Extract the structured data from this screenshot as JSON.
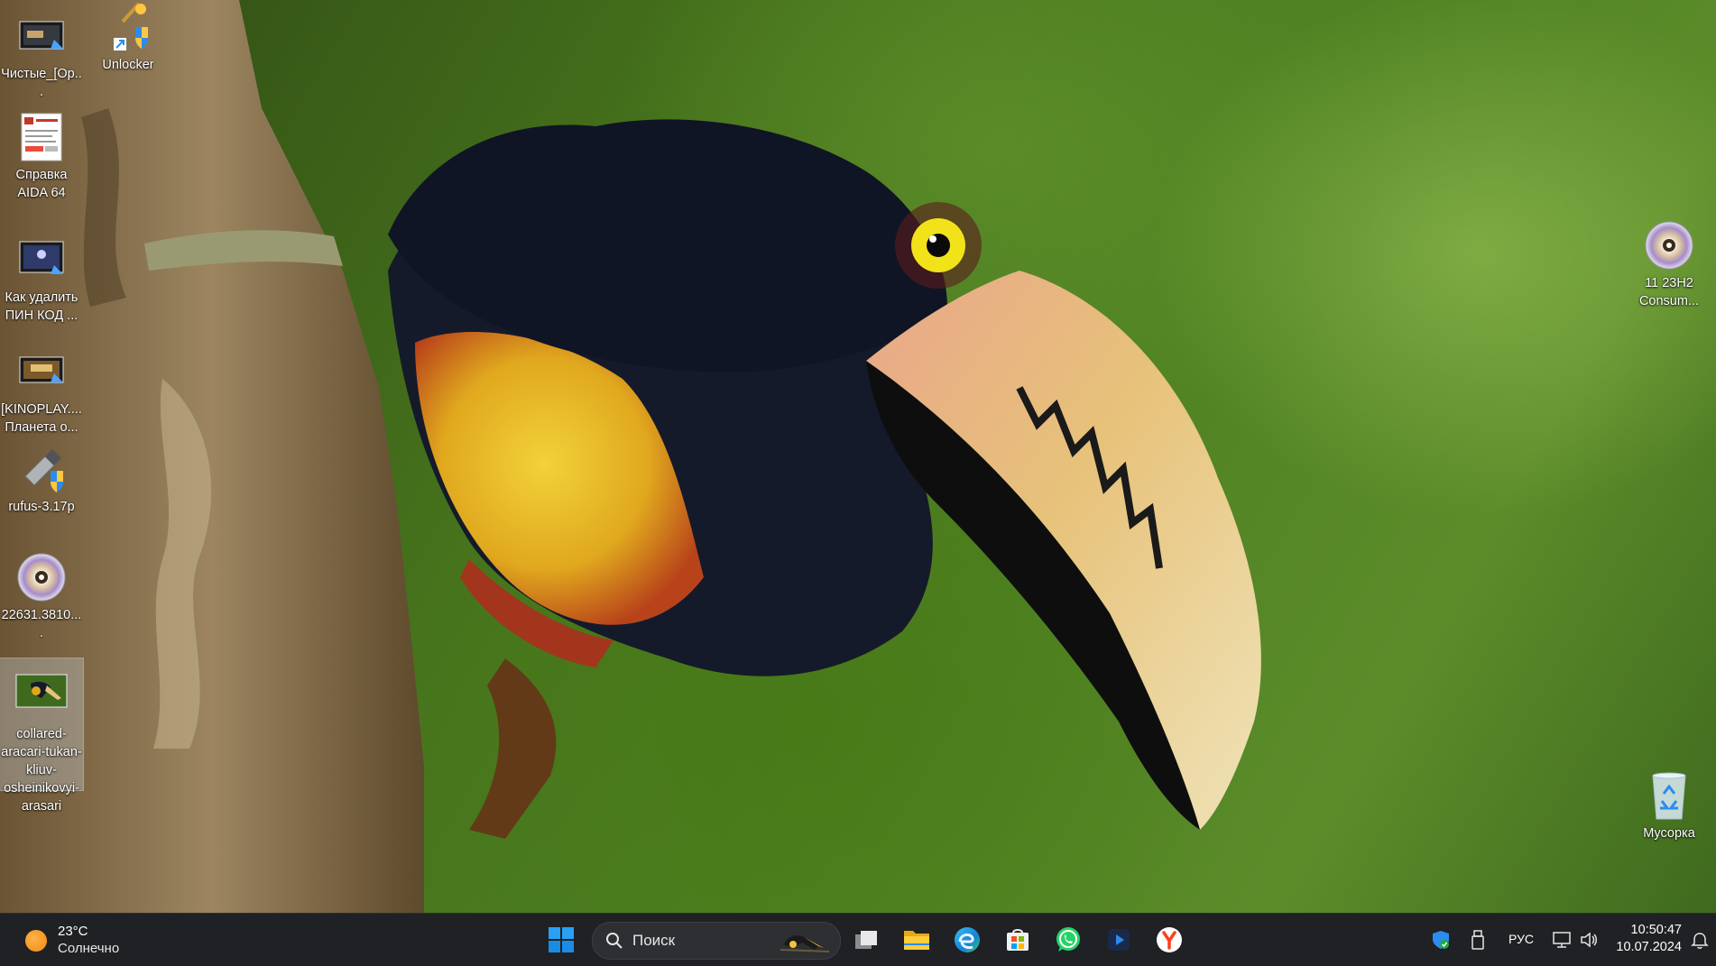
{
  "desktop": {
    "left_icons": [
      {
        "id": "video1",
        "label": "Чистые_[Ор...",
        "icon": "video-file-icon"
      },
      {
        "id": "unlocker",
        "label": "Unlocker",
        "icon": "unlocker-shortcut-icon"
      },
      {
        "id": "aida",
        "label": "Справка AIDA 64",
        "icon": "document-icon"
      },
      {
        "id": "video2",
        "label": "Как удалить ПИН КОД ...",
        "icon": "video-file-icon"
      },
      {
        "id": "video3",
        "label": "[KINOPLAY.... Планета о...",
        "icon": "video-file-icon"
      },
      {
        "id": "rufus",
        "label": "rufus-3.17p",
        "icon": "usb-drive-icon"
      },
      {
        "id": "iso1",
        "label": "22631.3810....",
        "icon": "disc-image-icon"
      },
      {
        "id": "photo",
        "label": "collared-aracari-tukan-kliuv-osheinikovyi-arasari",
        "icon": "image-file-icon"
      }
    ],
    "right_icons": [
      {
        "id": "iso2",
        "label": "11 23H2 Consum...",
        "icon": "disc-image-icon"
      },
      {
        "id": "recycle",
        "label": "Мусорка",
        "icon": "recycle-bin-icon"
      }
    ]
  },
  "taskbar": {
    "weather": {
      "temp": "23°C",
      "condition": "Солнечно",
      "icon": "sun-icon"
    },
    "search_placeholder": "Поиск",
    "pinned": [
      {
        "name": "start-button",
        "icon": "windows-logo-icon"
      },
      {
        "name": "task-view-button",
        "icon": "task-view-icon"
      },
      {
        "name": "file-explorer-button",
        "icon": "folder-icon"
      },
      {
        "name": "edge-button",
        "icon": "edge-icon"
      },
      {
        "name": "store-button",
        "icon": "store-icon"
      },
      {
        "name": "whatsapp-button",
        "icon": "whatsapp-icon"
      },
      {
        "name": "media-player-button",
        "icon": "media-player-icon"
      },
      {
        "name": "yandex-button",
        "icon": "yandex-icon"
      }
    ],
    "tray": {
      "language": "РУС",
      "time": "10:50:47",
      "date": "10.07.2024"
    }
  },
  "colors": {
    "taskbar_bg": "#1f2124",
    "accent_blue": "#2a8cf0",
    "whatsapp_green": "#25d366",
    "yandex_red": "#fc3f1d"
  }
}
